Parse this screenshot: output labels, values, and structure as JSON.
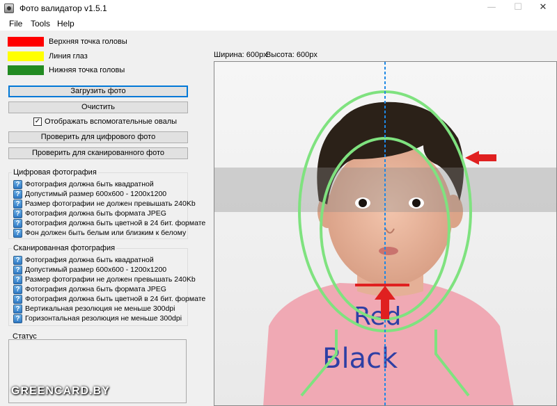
{
  "window": {
    "title": "Фото валидатор v1.5.1",
    "minimize": "—",
    "maximize": "☐",
    "close": "✕"
  },
  "menu": [
    "File",
    "Tools",
    "Help"
  ],
  "legend": [
    {
      "color": "#ff0000",
      "label": "Верхняя точка головы"
    },
    {
      "color": "#ffff00",
      "label": "Линия глаз"
    },
    {
      "color": "#228b22",
      "label": "Нижняя точка головы"
    }
  ],
  "buttons": {
    "load": "Загрузить фото",
    "clear": "Очистить",
    "check_digital": "Проверить для цифрового фото",
    "check_scanned": "Проверить для сканированного фото"
  },
  "show_ovals": {
    "label": "Отображать вспомогательные овалы",
    "checked": true,
    "mark": "✓"
  },
  "digital_group": {
    "title": "Цифровая фотография",
    "items": [
      "Фотография должна быть квадратной",
      "Допустимый размер 600x600 - 1200x1200",
      "Размер фотографии не должен превышать 240Kb",
      "Фотография должна быть формата JPEG",
      "Фотография должна быть цветной в 24 бит. формате",
      "Фон должен быть белым или близким к белому"
    ]
  },
  "scanned_group": {
    "title": "Сканированная фотография",
    "items": [
      "Фотография должна быть квадратной",
      "Допустимый размер 600x600 - 1200x1200",
      "Размер фотографии не должен превышать 240Kb",
      "Фотография должна быть формата JPEG",
      "Фотография должна быть цветной в 24 бит. формате",
      "Вертикальная резолюция не меньше 300dpi",
      "Горизонтальная резолюция не меньше 300dpi"
    ]
  },
  "status": {
    "title": "Статус"
  },
  "icons": {
    "status_icon": "?"
  },
  "dimensions": {
    "width": "Ширина: 600px",
    "height": "Высота: 600px"
  },
  "photo": {
    "shirt_text_1": "Red",
    "shirt_text_2": "Black",
    "overlay_color": "#7fe27f",
    "guide_line_color": "#1e88e5",
    "arrow_color": "#e02020"
  },
  "watermark": "GREENCARD.BY"
}
